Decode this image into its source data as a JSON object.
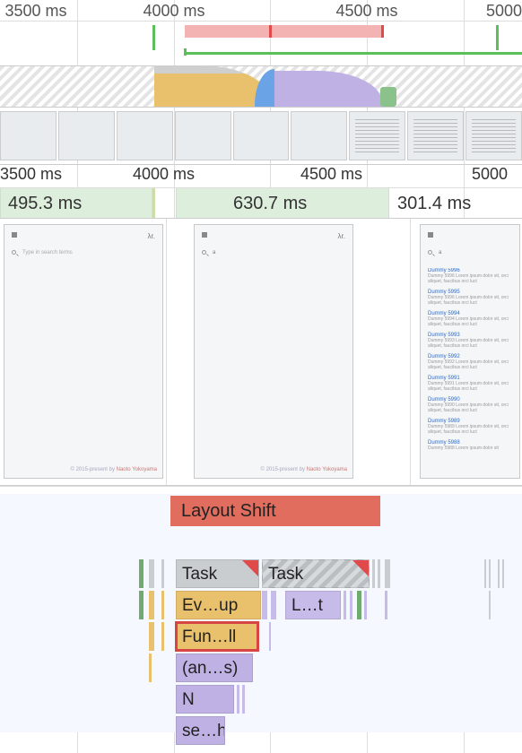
{
  "ruler_top": {
    "ticks": [
      "3500 ms",
      "4000 ms",
      "4500 ms",
      "5000"
    ]
  },
  "ruler_mid": {
    "ticks": [
      "3500 ms",
      "4000 ms",
      "4500 ms",
      "5000"
    ]
  },
  "timings": [
    {
      "label": "495.3 ms"
    },
    {
      "label": "630.7 ms"
    },
    {
      "label": "301.4 ms"
    }
  ],
  "shot_app_name": "λr.",
  "shot_search_placeholder": "Type in search terms",
  "shot_footer_prefix": "© 2015-present by ",
  "shot_footer_name": "Naoto Yokoyama",
  "shot_items": [
    {
      "title": "Dummy 5996",
      "body": "Dummy 5996 Lorem ipsum dolor sit, orci aliquet, faucibus orci luct"
    },
    {
      "title": "Dummy 5995",
      "body": "Dummy 5996 Lorem ipsum dolor sit, orci aliquet, faucibus orci luct"
    },
    {
      "title": "Dummy 5994",
      "body": "Dummy 5994 Lorem ipsum dolor sit, orci aliquet, faucibus orci luct"
    },
    {
      "title": "Dummy 5993",
      "body": "Dummy 5993 Lorem ipsum dolor sit, orci aliquet, faucibus orci luct"
    },
    {
      "title": "Dummy 5992",
      "body": "Dummy 5992 Lorem ipsum dolor sit, orci aliquet, faucibus orci luct"
    },
    {
      "title": "Dummy 5991",
      "body": "Dummy 5991 Lorem ipsum dolor sit, orci aliquet, faucibus orci luct"
    },
    {
      "title": "Dummy 5990",
      "body": "Dummy 5990 Lorem ipsum dolor sit, orci aliquet, faucibus orci luct"
    },
    {
      "title": "Dummy 5989",
      "body": "Dummy 5989 Lorem ipsum dolor sit, orci aliquet, faucibus orci luct"
    },
    {
      "title": "Dummy 5988",
      "body": "Dummy 5988 Lorem ipsum dolor sit"
    }
  ],
  "layout_shift_label": "Layout Shift",
  "flame": {
    "row0": [
      {
        "label": "Task"
      },
      {
        "label": "Task"
      }
    ],
    "row1": [
      {
        "label": "Ev…up"
      },
      {
        "label": "L…t"
      }
    ],
    "row2": [
      {
        "label": "Fun…ll"
      }
    ],
    "row3": [
      {
        "label": "(an…s)"
      }
    ],
    "row4": [
      {
        "label": "N"
      }
    ],
    "row5": [
      {
        "label": "se…h"
      }
    ]
  },
  "chart_data": {
    "type": "timeline",
    "x_unit": "ms",
    "x_range": [
      3400,
      5100
    ],
    "top_markers": {
      "long_task_range_ms": [
        4025,
        4470
      ],
      "red_ticks_ms": [
        4210,
        4465
      ],
      "green_ticks_ms": [
        3873,
        5000
      ],
      "green_underline_range_ms": [
        4025,
        5100
      ]
    },
    "cpu_colors_visible": [
      "yellow",
      "grey",
      "blue",
      "purple",
      "green",
      "hatched"
    ],
    "filmstrip_frames": 9,
    "timing_blocks": [
      {
        "label_ms": 495.3,
        "start_ms": 3400,
        "end_ms": 3875
      },
      {
        "label_ms": 630.7,
        "start_ms": 4025,
        "end_ms": 4475
      },
      {
        "label_ms": 301.4,
        "start_ms": 4475,
        "end_ms": 5100
      }
    ],
    "screenshots_count": 3,
    "layout_shift_range_ms": [
      3995,
      4475
    ],
    "flame_rows": [
      [
        {
          "name": "Task",
          "start_ms": 4025,
          "end_ms": 4210,
          "color": "grey",
          "long_task_corner": true
        },
        {
          "name": "Task",
          "start_ms": 4215,
          "end_ms": 4450,
          "color": "hatched",
          "long_task_corner": true
        }
      ],
      [
        {
          "name": "Evaluate Script …up",
          "start_ms": 4025,
          "end_ms": 4215,
          "color": "yellow"
        },
        {
          "name": "Layout …t",
          "start_ms": 4305,
          "end_ms": 4440,
          "color": "purple"
        }
      ],
      [
        {
          "name": "Function Call …ll",
          "start_ms": 4025,
          "end_ms": 4210,
          "color": "yellow",
          "selected": true
        }
      ],
      [
        {
          "name": "(anonymous) …s",
          "start_ms": 4025,
          "end_ms": 4200,
          "color": "purple"
        }
      ],
      [
        {
          "name": "N",
          "start_ms": 4025,
          "end_ms": 4170,
          "color": "purple"
        }
      ],
      [
        {
          "name": "se…h",
          "start_ms": 4025,
          "end_ms": 4140,
          "color": "purple"
        }
      ]
    ]
  }
}
